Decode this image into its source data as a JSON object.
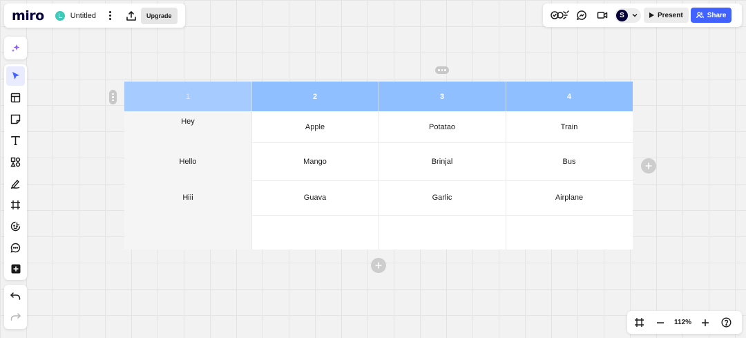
{
  "app": {
    "logo": "miro",
    "board_title": "Untitled",
    "upgrade_label": "Upgrade"
  },
  "topbar_right": {
    "present_label": "Present",
    "share_label": "Share",
    "avatar_initial": "S"
  },
  "table": {
    "headers": [
      "1",
      "2",
      "3",
      "4"
    ],
    "rows": [
      [
        "Hey",
        "Apple",
        "Potatao",
        "Train"
      ],
      [
        "Hello",
        "Mango",
        "Brinjal",
        "Bus"
      ],
      [
        "Hiii",
        "Guava",
        "Garlic",
        "Airplane"
      ],
      [
        "",
        "",
        "",
        ""
      ]
    ]
  },
  "zoom": {
    "level": "112%"
  },
  "colors": {
    "accent": "#4262ff",
    "header_fill": "#8fbfff",
    "board_icon": "#3fc9b8"
  }
}
